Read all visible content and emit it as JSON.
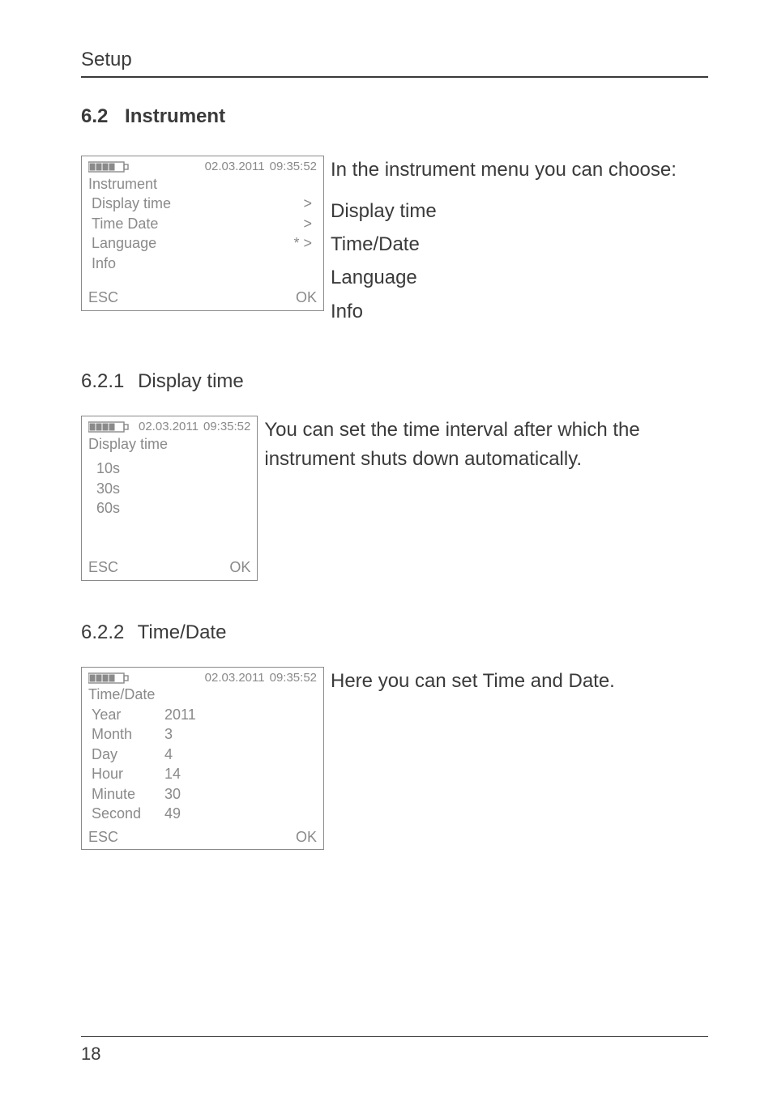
{
  "page": {
    "running_head": "Setup",
    "section_number": "6.2",
    "section_title": "Instrument",
    "page_number": "18"
  },
  "shared": {
    "date": "02.03.2011",
    "time": "09:35:52",
    "esc": "ESC",
    "ok": "OK"
  },
  "block1": {
    "lcd_title": "Instrument",
    "rows": [
      {
        "label": "Display time",
        "mark": ">"
      },
      {
        "label": "Time Date",
        "mark": ">"
      },
      {
        "label": "Language",
        "mark": "* >"
      },
      {
        "label": "Info",
        "mark": ""
      }
    ],
    "rhs_intro": "In the instrument menu you can choose:",
    "rhs_items": [
      "Display time",
      "Time/Date",
      "Language",
      "Info"
    ]
  },
  "sub1": {
    "num": "6.2.1",
    "title": "Display time",
    "lcd_title": "Display time",
    "options": [
      "10s",
      "30s",
      "60s"
    ],
    "rhs": "You can set the time interval after which the instrument shuts down automatically."
  },
  "sub2": {
    "num": "6.2.2",
    "title": "Time/Date",
    "lcd_title": "Time/Date",
    "fields": [
      {
        "name": "Year",
        "value": "2011"
      },
      {
        "name": "Month",
        "value": "3"
      },
      {
        "name": "Day",
        "value": "4"
      },
      {
        "name": "Hour",
        "value": "14"
      },
      {
        "name": "Minute",
        "value": "30"
      },
      {
        "name": "Second",
        "value": "49"
      }
    ],
    "rhs": "Here you can set Time and Date."
  }
}
